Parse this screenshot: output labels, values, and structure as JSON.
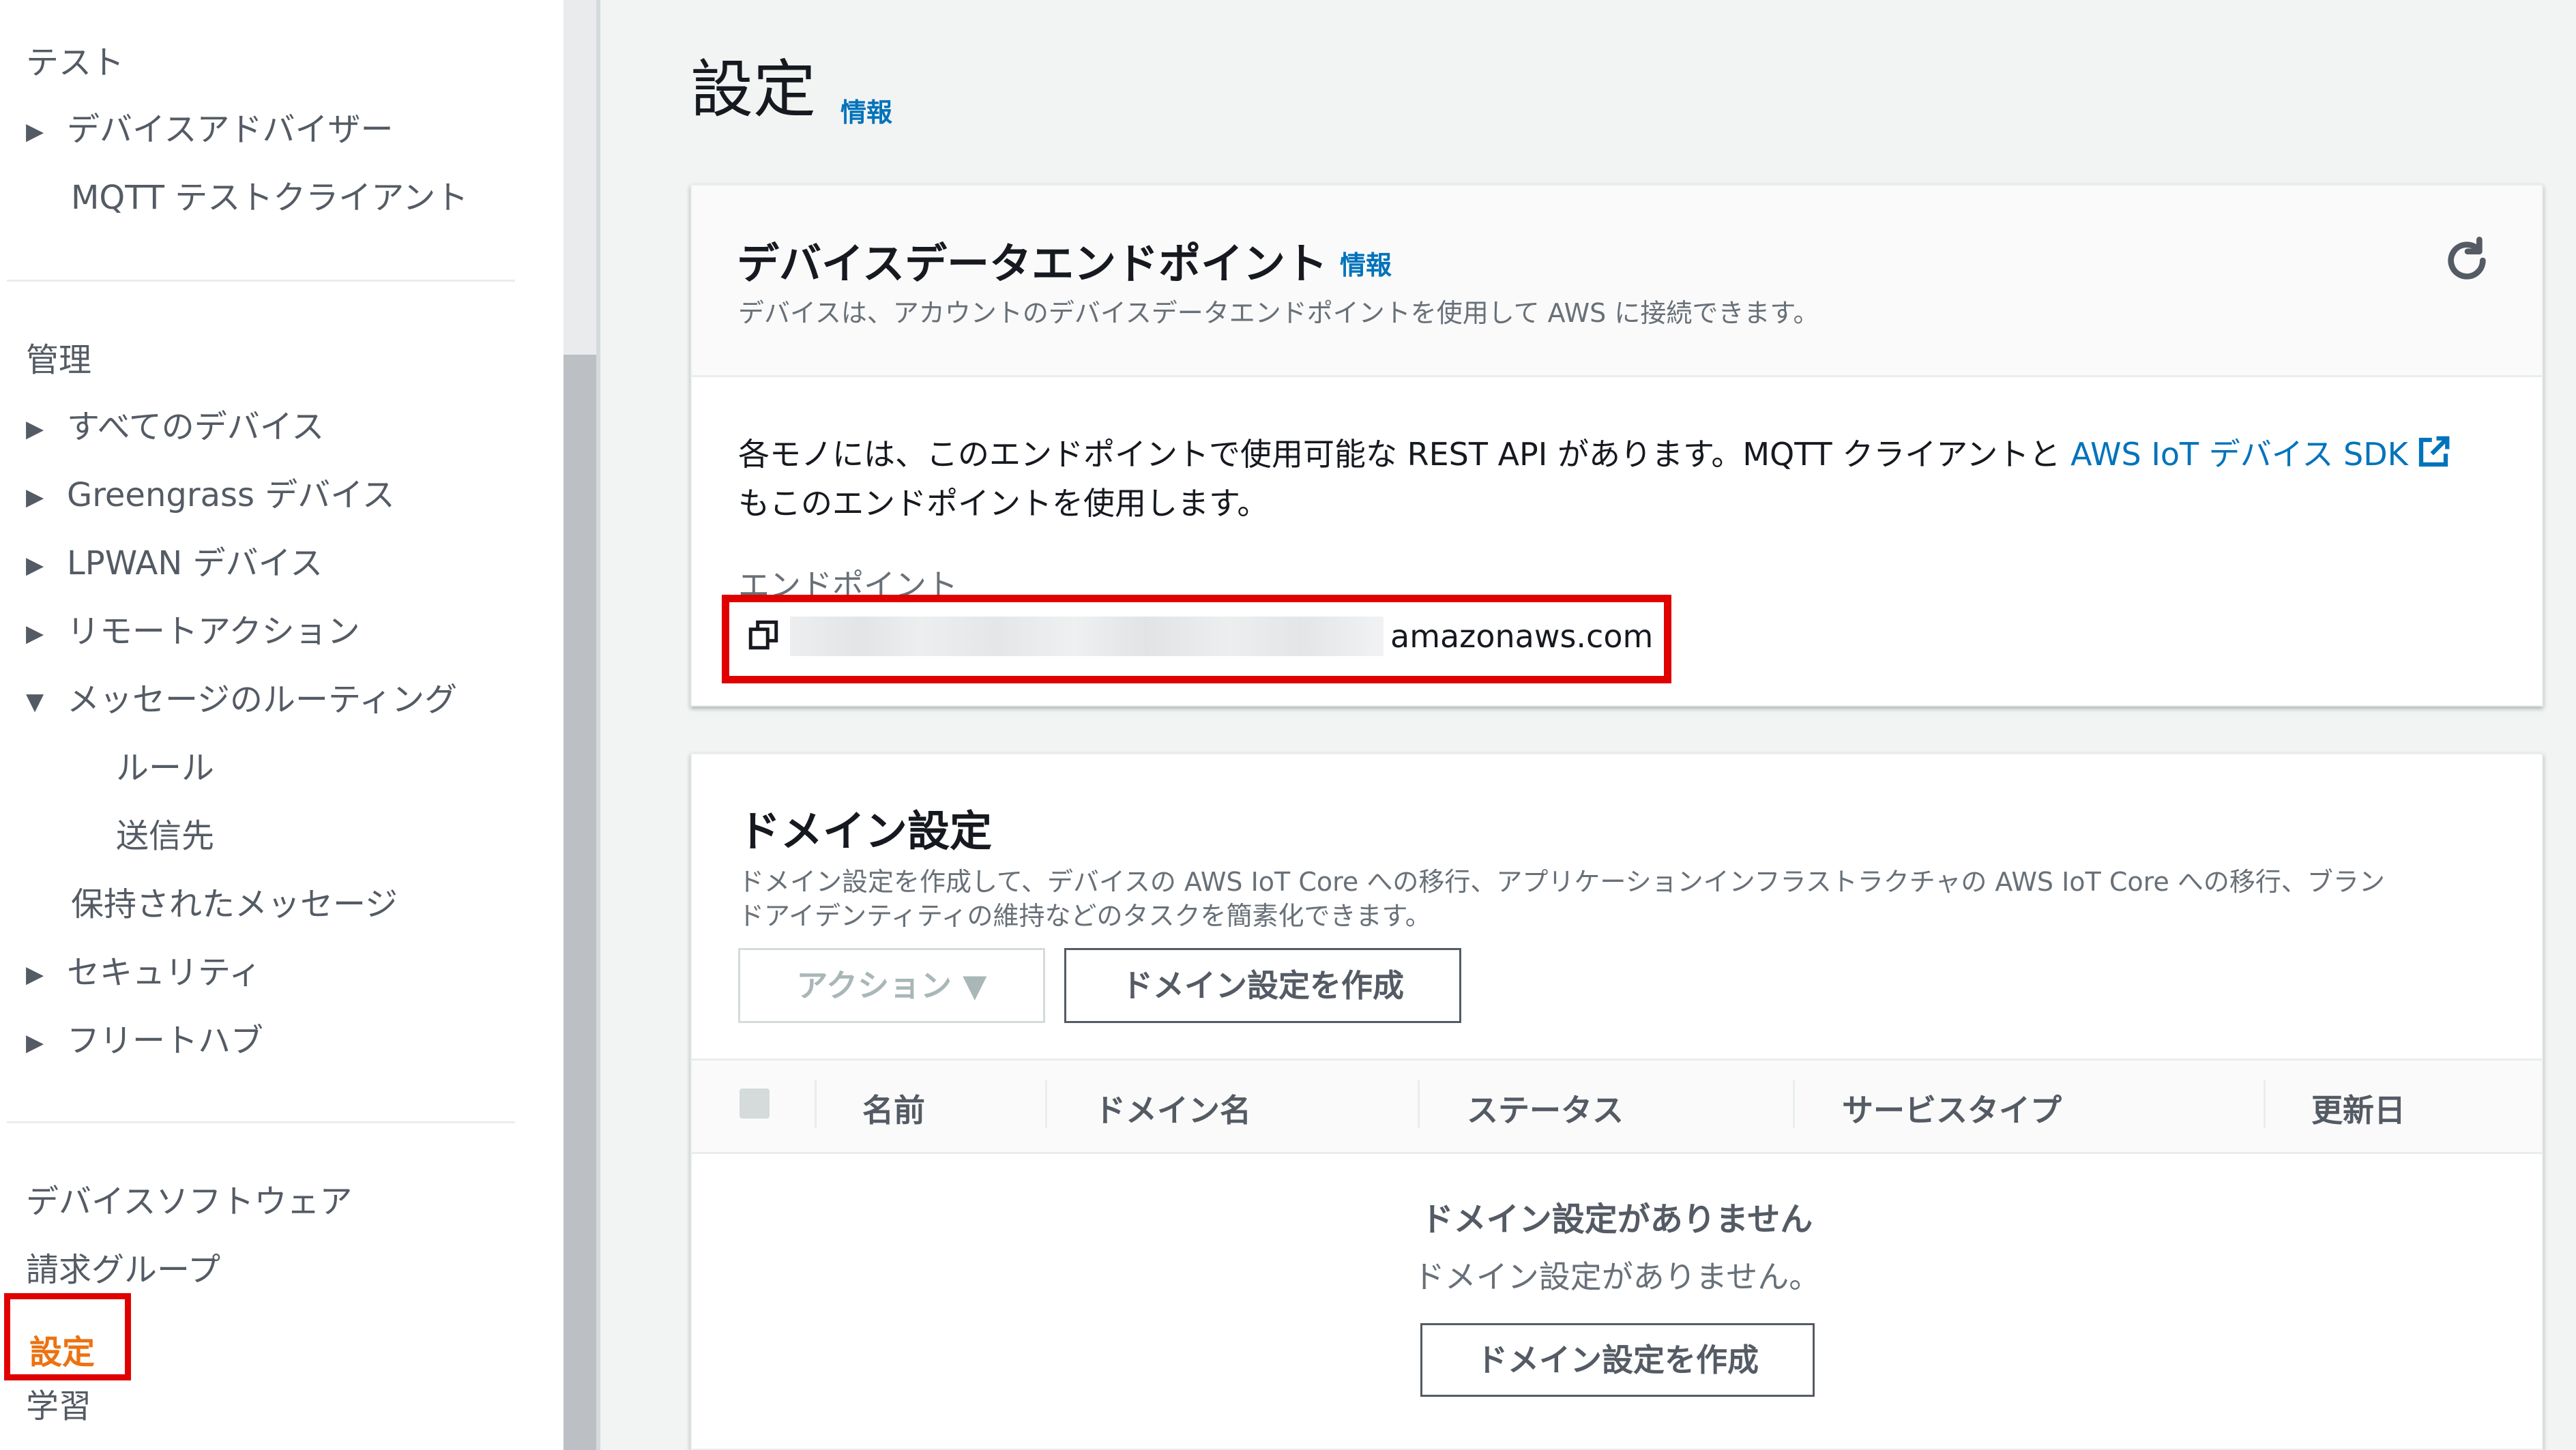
{
  "sidebar": {
    "items": [
      {
        "label": "テスト",
        "type": "section"
      },
      {
        "label": "デバイスアドバイザー",
        "arrow": "▶"
      },
      {
        "label": "MQTT テストクライアント"
      },
      {
        "label": "管理",
        "type": "section"
      },
      {
        "label": "すべてのデバイス",
        "arrow": "▶"
      },
      {
        "label": "Greengrass デバイス",
        "arrow": "▶"
      },
      {
        "label": "LPWAN デバイス",
        "arrow": "▶"
      },
      {
        "label": "リモートアクション",
        "arrow": "▶"
      },
      {
        "label": "メッセージのルーティング",
        "arrow": "▼"
      },
      {
        "label": "ルール"
      },
      {
        "label": "送信先"
      },
      {
        "label": "保持されたメッセージ"
      },
      {
        "label": "セキュリティ",
        "arrow": "▶"
      },
      {
        "label": "フリートハブ",
        "arrow": "▶"
      },
      {
        "label": "デバイスソフトウェア"
      },
      {
        "label": "請求グループ"
      },
      {
        "label": "設定",
        "active": true
      },
      {
        "label": "学習"
      }
    ]
  },
  "page": {
    "title": "設定",
    "info": "情報"
  },
  "endpoint_card": {
    "title": "デバイスデータエンドポイント",
    "info": "情報",
    "description": "デバイスは、アカウントのデバイスデータエンドポイントを使用して AWS に接続できます。",
    "body_line1": "各モノには、このエンドポイントで使用可能な REST API があります。MQTT クライアントと",
    "sdk_link": "AWS IoT デバイス SDK",
    "body_line2": "もこのエンドポイントを使用します。",
    "endpoint_label": "エンドポイント",
    "endpoint_value_suffix": "amazonaws.com"
  },
  "domain_card": {
    "title": "ドメイン設定",
    "description_line1": "ドメイン設定を作成して、デバイスの AWS IoT Core への移行、アプリケーションインフラストラクチャの AWS IoT Core への移行、ブラン",
    "description_line2": "ドアイデンティティの維持などのタスクを簡素化できます。",
    "actions_button": "アクション ▼",
    "create_button": "ドメイン設定を作成",
    "columns": [
      "名前",
      "ドメイン名",
      "ステータス",
      "サービスタイプ",
      "更新日"
    ],
    "empty_title": "ドメイン設定がありません",
    "empty_desc": "ドメイン設定がありません。",
    "empty_create_button": "ドメイン設定を作成"
  },
  "colors": {
    "accent_link": "#0073bb",
    "active_nav": "#ec7211",
    "highlight_box": "#e00000"
  }
}
